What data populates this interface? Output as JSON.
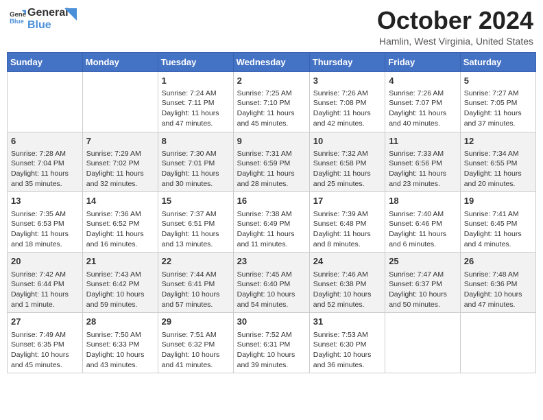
{
  "header": {
    "logo_general": "General",
    "logo_blue": "Blue",
    "month_title": "October 2024",
    "location": "Hamlin, West Virginia, United States"
  },
  "days_of_week": [
    "Sunday",
    "Monday",
    "Tuesday",
    "Wednesday",
    "Thursday",
    "Friday",
    "Saturday"
  ],
  "weeks": [
    [
      {
        "day": "",
        "sunrise": "",
        "sunset": "",
        "daylight": ""
      },
      {
        "day": "",
        "sunrise": "",
        "sunset": "",
        "daylight": ""
      },
      {
        "day": "1",
        "sunrise": "Sunrise: 7:24 AM",
        "sunset": "Sunset: 7:11 PM",
        "daylight": "Daylight: 11 hours and 47 minutes."
      },
      {
        "day": "2",
        "sunrise": "Sunrise: 7:25 AM",
        "sunset": "Sunset: 7:10 PM",
        "daylight": "Daylight: 11 hours and 45 minutes."
      },
      {
        "day": "3",
        "sunrise": "Sunrise: 7:26 AM",
        "sunset": "Sunset: 7:08 PM",
        "daylight": "Daylight: 11 hours and 42 minutes."
      },
      {
        "day": "4",
        "sunrise": "Sunrise: 7:26 AM",
        "sunset": "Sunset: 7:07 PM",
        "daylight": "Daylight: 11 hours and 40 minutes."
      },
      {
        "day": "5",
        "sunrise": "Sunrise: 7:27 AM",
        "sunset": "Sunset: 7:05 PM",
        "daylight": "Daylight: 11 hours and 37 minutes."
      }
    ],
    [
      {
        "day": "6",
        "sunrise": "Sunrise: 7:28 AM",
        "sunset": "Sunset: 7:04 PM",
        "daylight": "Daylight: 11 hours and 35 minutes."
      },
      {
        "day": "7",
        "sunrise": "Sunrise: 7:29 AM",
        "sunset": "Sunset: 7:02 PM",
        "daylight": "Daylight: 11 hours and 32 minutes."
      },
      {
        "day": "8",
        "sunrise": "Sunrise: 7:30 AM",
        "sunset": "Sunset: 7:01 PM",
        "daylight": "Daylight: 11 hours and 30 minutes."
      },
      {
        "day": "9",
        "sunrise": "Sunrise: 7:31 AM",
        "sunset": "Sunset: 6:59 PM",
        "daylight": "Daylight: 11 hours and 28 minutes."
      },
      {
        "day": "10",
        "sunrise": "Sunrise: 7:32 AM",
        "sunset": "Sunset: 6:58 PM",
        "daylight": "Daylight: 11 hours and 25 minutes."
      },
      {
        "day": "11",
        "sunrise": "Sunrise: 7:33 AM",
        "sunset": "Sunset: 6:56 PM",
        "daylight": "Daylight: 11 hours and 23 minutes."
      },
      {
        "day": "12",
        "sunrise": "Sunrise: 7:34 AM",
        "sunset": "Sunset: 6:55 PM",
        "daylight": "Daylight: 11 hours and 20 minutes."
      }
    ],
    [
      {
        "day": "13",
        "sunrise": "Sunrise: 7:35 AM",
        "sunset": "Sunset: 6:53 PM",
        "daylight": "Daylight: 11 hours and 18 minutes."
      },
      {
        "day": "14",
        "sunrise": "Sunrise: 7:36 AM",
        "sunset": "Sunset: 6:52 PM",
        "daylight": "Daylight: 11 hours and 16 minutes."
      },
      {
        "day": "15",
        "sunrise": "Sunrise: 7:37 AM",
        "sunset": "Sunset: 6:51 PM",
        "daylight": "Daylight: 11 hours and 13 minutes."
      },
      {
        "day": "16",
        "sunrise": "Sunrise: 7:38 AM",
        "sunset": "Sunset: 6:49 PM",
        "daylight": "Daylight: 11 hours and 11 minutes."
      },
      {
        "day": "17",
        "sunrise": "Sunrise: 7:39 AM",
        "sunset": "Sunset: 6:48 PM",
        "daylight": "Daylight: 11 hours and 8 minutes."
      },
      {
        "day": "18",
        "sunrise": "Sunrise: 7:40 AM",
        "sunset": "Sunset: 6:46 PM",
        "daylight": "Daylight: 11 hours and 6 minutes."
      },
      {
        "day": "19",
        "sunrise": "Sunrise: 7:41 AM",
        "sunset": "Sunset: 6:45 PM",
        "daylight": "Daylight: 11 hours and 4 minutes."
      }
    ],
    [
      {
        "day": "20",
        "sunrise": "Sunrise: 7:42 AM",
        "sunset": "Sunset: 6:44 PM",
        "daylight": "Daylight: 11 hours and 1 minute."
      },
      {
        "day": "21",
        "sunrise": "Sunrise: 7:43 AM",
        "sunset": "Sunset: 6:42 PM",
        "daylight": "Daylight: 10 hours and 59 minutes."
      },
      {
        "day": "22",
        "sunrise": "Sunrise: 7:44 AM",
        "sunset": "Sunset: 6:41 PM",
        "daylight": "Daylight: 10 hours and 57 minutes."
      },
      {
        "day": "23",
        "sunrise": "Sunrise: 7:45 AM",
        "sunset": "Sunset: 6:40 PM",
        "daylight": "Daylight: 10 hours and 54 minutes."
      },
      {
        "day": "24",
        "sunrise": "Sunrise: 7:46 AM",
        "sunset": "Sunset: 6:38 PM",
        "daylight": "Daylight: 10 hours and 52 minutes."
      },
      {
        "day": "25",
        "sunrise": "Sunrise: 7:47 AM",
        "sunset": "Sunset: 6:37 PM",
        "daylight": "Daylight: 10 hours and 50 minutes."
      },
      {
        "day": "26",
        "sunrise": "Sunrise: 7:48 AM",
        "sunset": "Sunset: 6:36 PM",
        "daylight": "Daylight: 10 hours and 47 minutes."
      }
    ],
    [
      {
        "day": "27",
        "sunrise": "Sunrise: 7:49 AM",
        "sunset": "Sunset: 6:35 PM",
        "daylight": "Daylight: 10 hours and 45 minutes."
      },
      {
        "day": "28",
        "sunrise": "Sunrise: 7:50 AM",
        "sunset": "Sunset: 6:33 PM",
        "daylight": "Daylight: 10 hours and 43 minutes."
      },
      {
        "day": "29",
        "sunrise": "Sunrise: 7:51 AM",
        "sunset": "Sunset: 6:32 PM",
        "daylight": "Daylight: 10 hours and 41 minutes."
      },
      {
        "day": "30",
        "sunrise": "Sunrise: 7:52 AM",
        "sunset": "Sunset: 6:31 PM",
        "daylight": "Daylight: 10 hours and 39 minutes."
      },
      {
        "day": "31",
        "sunrise": "Sunrise: 7:53 AM",
        "sunset": "Sunset: 6:30 PM",
        "daylight": "Daylight: 10 hours and 36 minutes."
      },
      {
        "day": "",
        "sunrise": "",
        "sunset": "",
        "daylight": ""
      },
      {
        "day": "",
        "sunrise": "",
        "sunset": "",
        "daylight": ""
      }
    ]
  ]
}
